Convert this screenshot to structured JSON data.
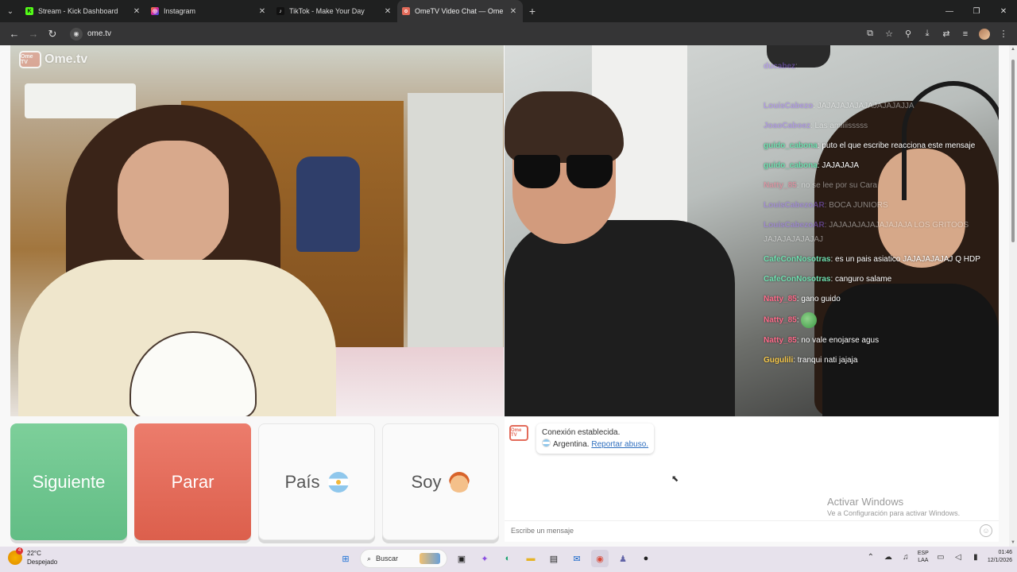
{
  "browser": {
    "tabs": [
      {
        "title": "Stream - Kick Dashboard",
        "favicon": "kick-icon",
        "color": "#53fc18",
        "active": false
      },
      {
        "title": "Instagram",
        "favicon": "instagram-icon",
        "color": "#d6249f",
        "active": false
      },
      {
        "title": "TikTok - Make Your Day",
        "favicon": "tiktok-icon",
        "color": "#111111",
        "active": false
      },
      {
        "title": "OmeTV Video Chat — Ome",
        "favicon": "ometv-icon",
        "color": "#e36b5a",
        "active": true
      }
    ],
    "url": "ome.tv"
  },
  "page": {
    "logo_badge": "Ome TV",
    "logo_text": "Ome.tv",
    "chat_overlay": [
      {
        "user": "ducabez",
        "text": "",
        "user_color": "#9b6bff",
        "faded": true
      },
      {
        "user": "",
        "text": "",
        "user_color": "#ffffff",
        "faded": true
      },
      {
        "user": "LouisCabezo",
        "text": "JAJAJAJAJAJAJAJAJAJJA",
        "user_color": "#9b6bff",
        "faded": true
      },
      {
        "user": "JoaoCaboez",
        "text": "Las amiiiisssss",
        "user_color": "#9b6bff",
        "faded": true
      },
      {
        "user": "guido_cabona",
        "text": "puto el que escribe reacciona este mensaje",
        "user_color": "#6fe0b0",
        "faded": false
      },
      {
        "user": "guido_cabona",
        "text": "JAJAJAJA",
        "user_color": "#6fe0b0",
        "faded": false
      },
      {
        "user": "Natty_85",
        "text": "no se lee por su Cara",
        "user_color": "#ff6b8a",
        "faded": true
      },
      {
        "user": "LouisCabezoAR",
        "text": "BOCA JUNIORS",
        "user_color": "#9b6bff",
        "faded": true
      },
      {
        "user": "LouisCabezoAR",
        "text": "JAJAJAJAJAJAJAJAJA LOS GRITOOS JAJAJAJAJAJAJ",
        "user_color": "#9b6bff",
        "faded": true
      },
      {
        "user": "CafeConNosotras",
        "text": "es un pais asiatico JAJAJAJAJAJ Q HDP",
        "user_color": "#6fe0b0",
        "faded": false
      },
      {
        "user": "CafeConNosotras",
        "text": "canguro salame",
        "user_color": "#6fe0b0",
        "faded": false
      },
      {
        "user": "Natty_85",
        "text": "gano guido",
        "user_color": "#ff6b8a",
        "faded": false
      },
      {
        "user": "Natty_85",
        "text": "",
        "user_color": "#ff6b8a",
        "faded": false,
        "emote": true
      },
      {
        "user": "Natty_85",
        "text": "no vale enojarse agus",
        "user_color": "#ff6b8a",
        "faded": false
      },
      {
        "user": "Gugulili",
        "text": "tranqui nati jajaja",
        "user_color": "#f6c84a",
        "faded": false
      }
    ],
    "buttons": {
      "next": "Siguiente",
      "stop": "Parar",
      "country": "País",
      "me": "Soy"
    },
    "system_message": {
      "avatar": "Ome TV",
      "line1": "Conexión establecida.",
      "country": "Argentina.",
      "report": "Reportar abuso."
    },
    "watermark": {
      "line1": "Activar Windows",
      "line2": "Ve a Configuración para activar Windows."
    },
    "message_placeholder": "Escribe un mensaje"
  },
  "taskbar": {
    "weather_temp": "22°C",
    "weather_desc": "Despejado",
    "notif_count": "4",
    "search_label": "Buscar",
    "lang_top": "ESP",
    "lang_bottom": "LAA",
    "time": "01:46",
    "date": "12/1/2026"
  }
}
